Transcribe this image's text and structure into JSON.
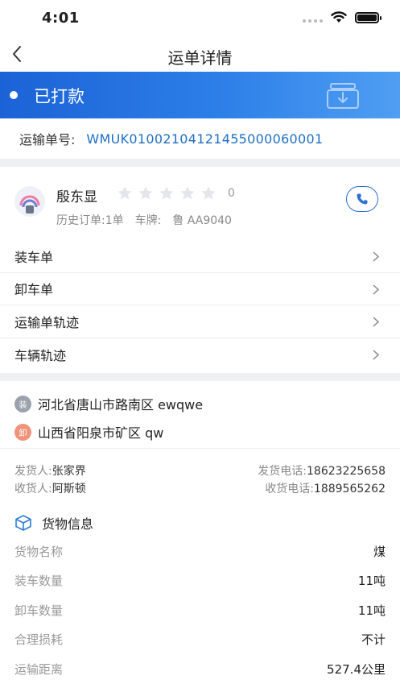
{
  "status_bar": {
    "time": "4:01"
  },
  "nav": {
    "title": "运单详情"
  },
  "status": {
    "text": "已打款"
  },
  "waybill": {
    "label": "运输单号:",
    "number": "WMUK01002104121455000060001"
  },
  "driver": {
    "name": "殷东显",
    "rating": "0",
    "rating_stars_filled": 0,
    "rating_stars_total": 5,
    "history_orders": "历史订单:1单",
    "plate_label": "车牌:",
    "plate": "鲁 AA9040"
  },
  "links": [
    {
      "label": "装车单"
    },
    {
      "label": "卸车单"
    },
    {
      "label": "运输单轨迹"
    },
    {
      "label": "车辆轨迹"
    }
  ],
  "addresses": {
    "load": {
      "badge": "装",
      "text": "河北省唐山市路南区 ewqwe",
      "color": "#9ba2ad"
    },
    "unload": {
      "badge": "卸",
      "text": "山西省阳泉市矿区 qw",
      "color": "#f0937a"
    }
  },
  "contacts": {
    "shipper_label": "发货人:",
    "shipper": "张家界",
    "shipper_phone_label": "发货电话:",
    "shipper_phone": "18623225658",
    "receiver_label": "收货人:",
    "receiver": "阿斯顿",
    "receiver_phone_label": "收货电话:",
    "receiver_phone": "1889565262"
  },
  "goods": {
    "title": "货物信息",
    "items": [
      {
        "label": "货物名称",
        "value": "煤"
      },
      {
        "label": "装车数量",
        "value": "11吨"
      },
      {
        "label": "卸车数量",
        "value": "11吨"
      },
      {
        "label": "合理损耗",
        "value": "不计"
      },
      {
        "label": "运输距离",
        "value": "527.4公里"
      }
    ]
  },
  "colors": {
    "accent": "#2d7fe8",
    "link": "#1f6fc5",
    "star": "#e3e6eb"
  }
}
